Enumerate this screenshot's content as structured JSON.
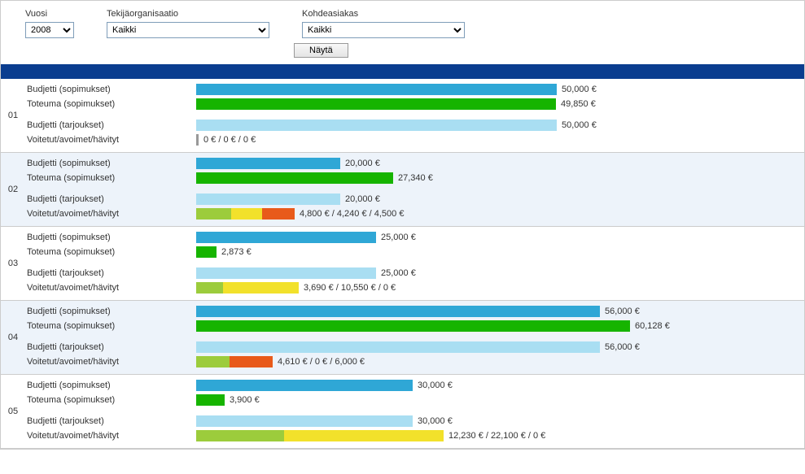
{
  "filters": {
    "year": {
      "label": "Vuosi",
      "value": "2008"
    },
    "org": {
      "label": "Tekijäorganisaatio",
      "value": "Kaikki"
    },
    "cust": {
      "label": "Kohdeasiakas",
      "value": "Kaikki"
    },
    "show_button": "Näytä"
  },
  "row_labels": {
    "budget_contracts": "Budjetti (sopimukset)",
    "actual_contracts": "Toteuma (sopimukset)",
    "budget_offers": "Budjetti (tarjoukset)",
    "won_open_lost": "Voitetut/avoimet/hävityt"
  },
  "chart_data": {
    "type": "bar",
    "x_unit": "€",
    "x_max": 70000,
    "colors": {
      "budget": "#2fa7d6",
      "actual": "#16b400",
      "offer": "#a9def2",
      "won": "#9ccc3c",
      "open": "#f2e12b",
      "lost": "#e85a1a"
    },
    "months": [
      {
        "id": "01",
        "budget_contracts": 50000,
        "actual_contracts": 49850,
        "budget_offers": 50000,
        "won": 0,
        "open": 0,
        "lost": 0
      },
      {
        "id": "02",
        "budget_contracts": 20000,
        "actual_contracts": 27340,
        "budget_offers": 20000,
        "won": 4800,
        "open": 4240,
        "lost": 4500
      },
      {
        "id": "03",
        "budget_contracts": 25000,
        "actual_contracts": 2873,
        "budget_offers": 25000,
        "won": 3690,
        "open": 10550,
        "lost": 0
      },
      {
        "id": "04",
        "budget_contracts": 56000,
        "actual_contracts": 60128,
        "budget_offers": 56000,
        "won": 4610,
        "open": 0,
        "lost": 6000
      },
      {
        "id": "05",
        "budget_contracts": 30000,
        "actual_contracts": 3900,
        "budget_offers": 30000,
        "won": 12230,
        "open": 22100,
        "lost": 0
      }
    ]
  }
}
